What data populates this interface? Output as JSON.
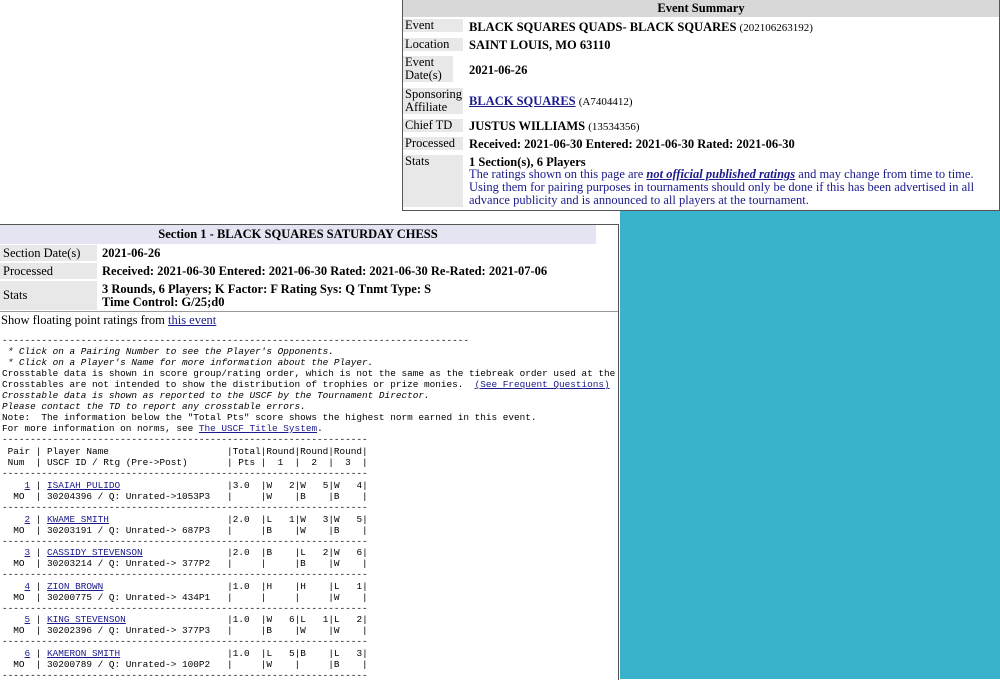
{
  "summary": {
    "header": "Event Summary",
    "rows": {
      "event_label": "Event",
      "event_value": "BLACK SQUARES QUADS- BLACK SQUARES",
      "event_id": "(202106263192)",
      "location_label": "Location",
      "location_value": "SAINT LOUIS, MO  63110",
      "date_label": "Event Date(s)",
      "date_value": "2021-06-26",
      "affiliate_label": "Sponsoring Affiliate",
      "affiliate_value": "BLACK SQUARES",
      "affiliate_id": "(A7404412)",
      "chief_label": "Chief  TD",
      "chief_value": "JUSTUS WILLIAMS",
      "chief_id": "(13534356)",
      "processed_label": "Processed",
      "processed_value": "Received: 2021-06-30   Entered: 2021-06-30   Rated: 2021-06-30",
      "stats_label": "Stats",
      "stats_value": "1 Section(s),  6 Players"
    },
    "note_pre": "The ratings shown on this page are ",
    "note_link": "not official published ratings",
    "note_post": " and may change from time to time. Using them for pairing purposes in tournaments should only be done if this has been advertised in all advance publicity and is announced to all players at the tournament."
  },
  "section": {
    "header": "Section 1 - BLACK SQUARES SATURDAY CHESS",
    "date_label": "Section Date(s)",
    "date_value": "2021-06-26",
    "processed_label": "Processed",
    "processed_value": "Received: 2021-06-30   Entered: 2021-06-30   Rated: 2021-06-30 Re-Rated: 2021-07-06",
    "stats_label": "Stats",
    "stats_line1": "3 Rounds,  6 Players;  K Factor: F  Rating Sys: Q  Tnmt Type: S",
    "stats_line2": "Time Control: G/25;d0",
    "float_pre": "Show floating point ratings from ",
    "float_link": "this event"
  },
  "notes": {
    "rule": "-----------------------------------------------------------------------------------",
    "n1": " * Click on a Pairing Number to see the Player's Opponents.",
    "n2": " * Click on a Player's Name for more information about the Player.",
    "n3": "Crosstable data is shown in score group/rating order, which is not the same as the tiebreak order used at the event.",
    "n4a": "Crosstables are not intended to show the distribution of trophies or prize monies.  ",
    "n4link": "(See Frequent Questions)",
    "n5": "Crosstable data is shown as reported to the USCF by the Tournament Director.",
    "n6": "Please contact the TD to report any crosstable errors.",
    "n7": "Note:  The information below the \"Total Pts\" score shows the highest norm earned in this event.",
    "n8a": "For more information on norms, see ",
    "n8link": "The USCF Title System",
    "n8b": "."
  },
  "crosstable": {
    "rule": "-----------------------------------------------------------------",
    "head1": " Pair | Player Name                     |Total|Round|Round|Round|",
    "head2": " Num  | USCF ID / Rtg (Pre->Post)       | Pts |  1  |  2  |  3  |",
    "players": [
      {
        "num": "1",
        "name": "ISAIAH PULIDO",
        "l1_rest": "                   |3.0  |W   2|W   5|W   4|",
        "l2": "  MO  | 30204396 / Q: Unrated->1053P3   |     |W    |B    |B    |"
      },
      {
        "num": "2",
        "name": "KWAME SMITH",
        "l1_rest": "                     |2.0  |L   1|W   3|W   5|",
        "l2": "  MO  | 30203191 / Q: Unrated-> 687P3   |     |B    |W    |B    |"
      },
      {
        "num": "3",
        "name": "CASSIDY STEVENSON",
        "l1_rest": "               |2.0  |B    |L   2|W   6|",
        "l2": "  MO  | 30203214 / Q: Unrated-> 377P2   |     |     |B    |W    |"
      },
      {
        "num": "4",
        "name": "ZION BROWN",
        "l1_rest": "                      |1.0  |H    |H    |L   1|",
        "l2": "  MO  | 30200775 / Q: Unrated-> 434P1   |     |     |     |W    |"
      },
      {
        "num": "5",
        "name": "KING STEVENSON",
        "l1_rest": "                  |1.0  |W   6|L   1|L   2|",
        "l2": "  MO  | 30202396 / Q: Unrated-> 377P3   |     |B    |W    |W    |"
      },
      {
        "num": "6",
        "name": "KAMERON SMITH",
        "l1_rest": "                   |1.0  |L   5|B    |L   3|",
        "l2": "  MO  | 30200789 / Q: Unrated-> 100P2   |     |W    |     |B    |"
      }
    ]
  }
}
